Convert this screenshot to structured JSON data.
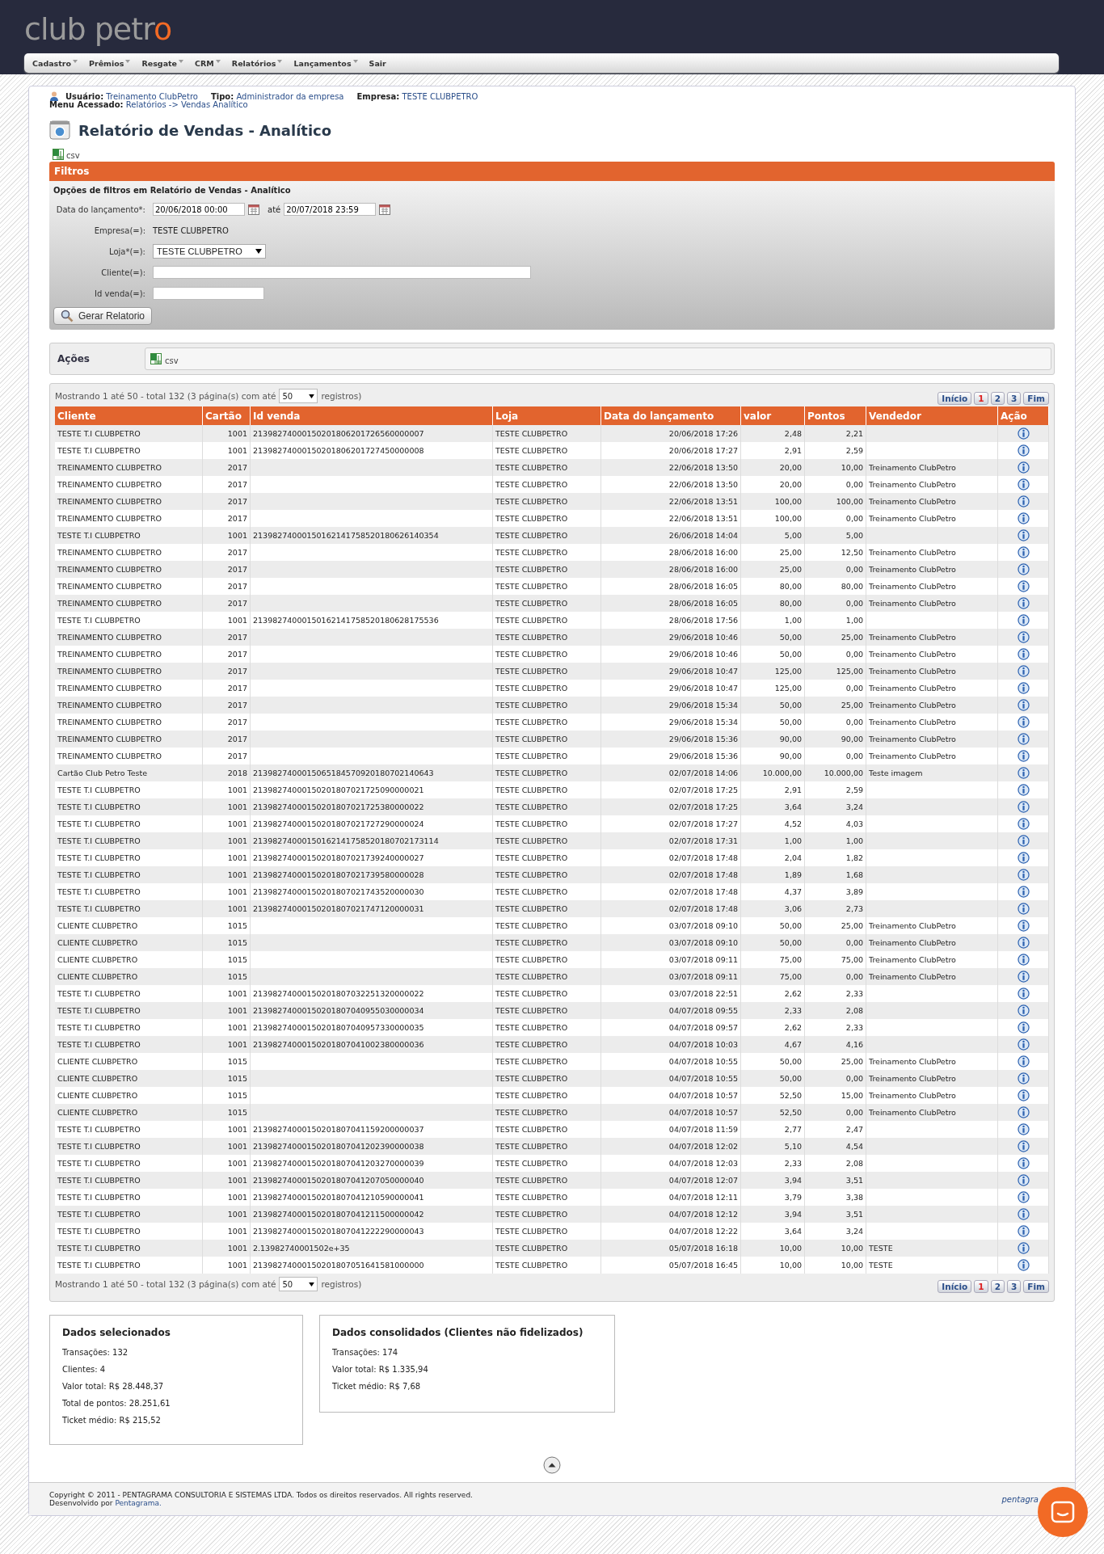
{
  "logo": {
    "text": "club petr",
    "accent": "o"
  },
  "menu": [
    {
      "label": "Cadastro",
      "dropdown": true
    },
    {
      "label": "Prêmios",
      "dropdown": true
    },
    {
      "label": "Resgate",
      "dropdown": true
    },
    {
      "label": "CRM",
      "dropdown": true
    },
    {
      "label": "Relatórios",
      "dropdown": true
    },
    {
      "label": "Lançamentos",
      "dropdown": true
    },
    {
      "label": "Sair",
      "dropdown": false
    }
  ],
  "user_info": [
    {
      "label": "Usuário:",
      "value": "Treinamento ClubPetro"
    },
    {
      "label": "Tipo:",
      "value": "Administrador da empresa"
    },
    {
      "label": "Empresa:",
      "value": "TESTE CLUBPETRO"
    }
  ],
  "menu_path": {
    "label": "Menu Acessado:",
    "value": "Relatórios -> Vendas Analítico"
  },
  "page_title": "Relatório de Vendas - Analítico",
  "export_link": "csv",
  "filters": {
    "title": "Filtros",
    "subtitle": "Opções de filtros em Relatório de Vendas - Analítico",
    "date": {
      "label": "Data do lançamento*:",
      "from": "20/06/2018 00:00",
      "separator": "até",
      "to": "20/07/2018 23:59"
    },
    "company": {
      "label": "Empresa(=):",
      "value": "TESTE CLUBPETRO"
    },
    "store": {
      "label": "Loja*(=):",
      "value": "TESTE CLUBPETRO"
    },
    "client": {
      "label": "Cliente(=):"
    },
    "sale_id": {
      "label": "Id venda(=):"
    },
    "button": "Gerar Relatorio"
  },
  "actions": {
    "label": "Ações",
    "link": "csv"
  },
  "pagers": [
    {
      "summary": "Mostrando 1 até 50 - total 132 (3 página(s) com até",
      "per_page": "50",
      "suffix": "registros)",
      "pages": [
        {
          "label": "Início",
          "selected": false
        },
        {
          "label": "1",
          "selected": true
        },
        {
          "label": "2",
          "selected": false
        },
        {
          "label": "3",
          "selected": false
        },
        {
          "label": "Fim",
          "selected": false
        }
      ]
    },
    {
      "summary": "Mostrando 1 até 50 - total 132 (3 página(s) com até",
      "per_page": "50",
      "suffix": "registros)",
      "pages": [
        {
          "label": "Início",
          "selected": false
        },
        {
          "label": "1",
          "selected": true
        },
        {
          "label": "2",
          "selected": false
        },
        {
          "label": "3",
          "selected": false
        },
        {
          "label": "Fim",
          "selected": false
        }
      ]
    }
  ],
  "table": {
    "columns": [
      "Cliente",
      "Cartão",
      "Id venda",
      "Loja",
      "Data do lançamento",
      "valor",
      "Pontos",
      "Vendedor",
      "Ação"
    ],
    "rows": [
      [
        "TESTE T.I CLUBPETRO",
        "1001",
        "21398274000150201806201726560000007",
        "TESTE CLUBPETRO",
        "20/06/2018 17:26",
        "2,48",
        "2,21",
        ""
      ],
      [
        "TESTE T.I CLUBPETRO",
        "1001",
        "21398274000150201806201727450000008",
        "TESTE CLUBPETRO",
        "20/06/2018 17:27",
        "2,91",
        "2,59",
        ""
      ],
      [
        "TREINAMENTO CLUBPETRO",
        "2017",
        "",
        "TESTE CLUBPETRO",
        "22/06/2018 13:50",
        "20,00",
        "10,00",
        "Treinamento ClubPetro"
      ],
      [
        "TREINAMENTO CLUBPETRO",
        "2017",
        "",
        "TESTE CLUBPETRO",
        "22/06/2018 13:50",
        "20,00",
        "0,00",
        "Treinamento ClubPetro"
      ],
      [
        "TREINAMENTO CLUBPETRO",
        "2017",
        "",
        "TESTE CLUBPETRO",
        "22/06/2018 13:51",
        "100,00",
        "100,00",
        "Treinamento ClubPetro"
      ],
      [
        "TREINAMENTO CLUBPETRO",
        "2017",
        "",
        "TESTE CLUBPETRO",
        "22/06/2018 13:51",
        "100,00",
        "0,00",
        "Treinamento ClubPetro"
      ],
      [
        "TESTE T.I CLUBPETRO",
        "1001",
        "21398274000150162141758520180626140354",
        "TESTE CLUBPETRO",
        "26/06/2018 14:04",
        "5,00",
        "5,00",
        ""
      ],
      [
        "TREINAMENTO CLUBPETRO",
        "2017",
        "",
        "TESTE CLUBPETRO",
        "28/06/2018 16:00",
        "25,00",
        "12,50",
        "Treinamento ClubPetro"
      ],
      [
        "TREINAMENTO CLUBPETRO",
        "2017",
        "",
        "TESTE CLUBPETRO",
        "28/06/2018 16:00",
        "25,00",
        "0,00",
        "Treinamento ClubPetro"
      ],
      [
        "TREINAMENTO CLUBPETRO",
        "2017",
        "",
        "TESTE CLUBPETRO",
        "28/06/2018 16:05",
        "80,00",
        "80,00",
        "Treinamento ClubPetro"
      ],
      [
        "TREINAMENTO CLUBPETRO",
        "2017",
        "",
        "TESTE CLUBPETRO",
        "28/06/2018 16:05",
        "80,00",
        "0,00",
        "Treinamento ClubPetro"
      ],
      [
        "TESTE T.I CLUBPETRO",
        "1001",
        "21398274000150162141758520180628175536",
        "TESTE CLUBPETRO",
        "28/06/2018 17:56",
        "1,00",
        "1,00",
        ""
      ],
      [
        "TREINAMENTO CLUBPETRO",
        "2017",
        "",
        "TESTE CLUBPETRO",
        "29/06/2018 10:46",
        "50,00",
        "25,00",
        "Treinamento ClubPetro"
      ],
      [
        "TREINAMENTO CLUBPETRO",
        "2017",
        "",
        "TESTE CLUBPETRO",
        "29/06/2018 10:46",
        "50,00",
        "0,00",
        "Treinamento ClubPetro"
      ],
      [
        "TREINAMENTO CLUBPETRO",
        "2017",
        "",
        "TESTE CLUBPETRO",
        "29/06/2018 10:47",
        "125,00",
        "125,00",
        "Treinamento ClubPetro"
      ],
      [
        "TREINAMENTO CLUBPETRO",
        "2017",
        "",
        "TESTE CLUBPETRO",
        "29/06/2018 10:47",
        "125,00",
        "0,00",
        "Treinamento ClubPetro"
      ],
      [
        "TREINAMENTO CLUBPETRO",
        "2017",
        "",
        "TESTE CLUBPETRO",
        "29/06/2018 15:34",
        "50,00",
        "25,00",
        "Treinamento ClubPetro"
      ],
      [
        "TREINAMENTO CLUBPETRO",
        "2017",
        "",
        "TESTE CLUBPETRO",
        "29/06/2018 15:34",
        "50,00",
        "0,00",
        "Treinamento ClubPetro"
      ],
      [
        "TREINAMENTO CLUBPETRO",
        "2017",
        "",
        "TESTE CLUBPETRO",
        "29/06/2018 15:36",
        "90,00",
        "90,00",
        "Treinamento ClubPetro"
      ],
      [
        "TREINAMENTO CLUBPETRO",
        "2017",
        "",
        "TESTE CLUBPETRO",
        "29/06/2018 15:36",
        "90,00",
        "0,00",
        "Treinamento ClubPetro"
      ],
      [
        "Cartão Club Petro Teste",
        "2018",
        "2139827400015065184570920180702140643",
        "TESTE CLUBPETRO",
        "02/07/2018 14:06",
        "10.000,00",
        "10.000,00",
        "Teste imagem"
      ],
      [
        "TESTE T.I CLUBPETRO",
        "1001",
        "21398274000150201807021725090000021",
        "TESTE CLUBPETRO",
        "02/07/2018 17:25",
        "2,91",
        "2,59",
        ""
      ],
      [
        "TESTE T.I CLUBPETRO",
        "1001",
        "21398274000150201807021725380000022",
        "TESTE CLUBPETRO",
        "02/07/2018 17:25",
        "3,64",
        "3,24",
        ""
      ],
      [
        "TESTE T.I CLUBPETRO",
        "1001",
        "21398274000150201807021727290000024",
        "TESTE CLUBPETRO",
        "02/07/2018 17:27",
        "4,52",
        "4,03",
        ""
      ],
      [
        "TESTE T.I CLUBPETRO",
        "1001",
        "21398274000150162141758520180702173114",
        "TESTE CLUBPETRO",
        "02/07/2018 17:31",
        "1,00",
        "1,00",
        ""
      ],
      [
        "TESTE T.I CLUBPETRO",
        "1001",
        "21398274000150201807021739240000027",
        "TESTE CLUBPETRO",
        "02/07/2018 17:48",
        "2,04",
        "1,82",
        ""
      ],
      [
        "TESTE T.I CLUBPETRO",
        "1001",
        "21398274000150201807021739580000028",
        "TESTE CLUBPETRO",
        "02/07/2018 17:48",
        "1,89",
        "1,68",
        ""
      ],
      [
        "TESTE T.I CLUBPETRO",
        "1001",
        "21398274000150201807021743520000030",
        "TESTE CLUBPETRO",
        "02/07/2018 17:48",
        "4,37",
        "3,89",
        ""
      ],
      [
        "TESTE T.I CLUBPETRO",
        "1001",
        "21398274000150201807021747120000031",
        "TESTE CLUBPETRO",
        "02/07/2018 17:48",
        "3,06",
        "2,73",
        ""
      ],
      [
        "CLIENTE CLUBPETRO",
        "1015",
        "",
        "TESTE CLUBPETRO",
        "03/07/2018 09:10",
        "50,00",
        "25,00",
        "Treinamento ClubPetro"
      ],
      [
        "CLIENTE CLUBPETRO",
        "1015",
        "",
        "TESTE CLUBPETRO",
        "03/07/2018 09:10",
        "50,00",
        "0,00",
        "Treinamento ClubPetro"
      ],
      [
        "CLIENTE CLUBPETRO",
        "1015",
        "",
        "TESTE CLUBPETRO",
        "03/07/2018 09:11",
        "75,00",
        "75,00",
        "Treinamento ClubPetro"
      ],
      [
        "CLIENTE CLUBPETRO",
        "1015",
        "",
        "TESTE CLUBPETRO",
        "03/07/2018 09:11",
        "75,00",
        "0,00",
        "Treinamento ClubPetro"
      ],
      [
        "TESTE T.I CLUBPETRO",
        "1001",
        "21398274000150201807032251320000022",
        "TESTE CLUBPETRO",
        "03/07/2018 22:51",
        "2,62",
        "2,33",
        ""
      ],
      [
        "TESTE T.I CLUBPETRO",
        "1001",
        "21398274000150201807040955030000034",
        "TESTE CLUBPETRO",
        "04/07/2018 09:55",
        "2,33",
        "2,08",
        ""
      ],
      [
        "TESTE T.I CLUBPETRO",
        "1001",
        "21398274000150201807040957330000035",
        "TESTE CLUBPETRO",
        "04/07/2018 09:57",
        "2,62",
        "2,33",
        ""
      ],
      [
        "TESTE T.I CLUBPETRO",
        "1001",
        "21398274000150201807041002380000036",
        "TESTE CLUBPETRO",
        "04/07/2018 10:03",
        "4,67",
        "4,16",
        ""
      ],
      [
        "CLIENTE CLUBPETRO",
        "1015",
        "",
        "TESTE CLUBPETRO",
        "04/07/2018 10:55",
        "50,00",
        "25,00",
        "Treinamento ClubPetro"
      ],
      [
        "CLIENTE CLUBPETRO",
        "1015",
        "",
        "TESTE CLUBPETRO",
        "04/07/2018 10:55",
        "50,00",
        "0,00",
        "Treinamento ClubPetro"
      ],
      [
        "CLIENTE CLUBPETRO",
        "1015",
        "",
        "TESTE CLUBPETRO",
        "04/07/2018 10:57",
        "52,50",
        "15,00",
        "Treinamento ClubPetro"
      ],
      [
        "CLIENTE CLUBPETRO",
        "1015",
        "",
        "TESTE CLUBPETRO",
        "04/07/2018 10:57",
        "52,50",
        "0,00",
        "Treinamento ClubPetro"
      ],
      [
        "TESTE T.I CLUBPETRO",
        "1001",
        "21398274000150201807041159200000037",
        "TESTE CLUBPETRO",
        "04/07/2018 11:59",
        "2,77",
        "2,47",
        ""
      ],
      [
        "TESTE T.I CLUBPETRO",
        "1001",
        "21398274000150201807041202390000038",
        "TESTE CLUBPETRO",
        "04/07/2018 12:02",
        "5,10",
        "4,54",
        ""
      ],
      [
        "TESTE T.I CLUBPETRO",
        "1001",
        "21398274000150201807041203270000039",
        "TESTE CLUBPETRO",
        "04/07/2018 12:03",
        "2,33",
        "2,08",
        ""
      ],
      [
        "TESTE T.I CLUBPETRO",
        "1001",
        "21398274000150201807041207050000040",
        "TESTE CLUBPETRO",
        "04/07/2018 12:07",
        "3,94",
        "3,51",
        ""
      ],
      [
        "TESTE T.I CLUBPETRO",
        "1001",
        "21398274000150201807041210590000041",
        "TESTE CLUBPETRO",
        "04/07/2018 12:11",
        "3,79",
        "3,38",
        ""
      ],
      [
        "TESTE T.I CLUBPETRO",
        "1001",
        "21398274000150201807041211500000042",
        "TESTE CLUBPETRO",
        "04/07/2018 12:12",
        "3,94",
        "3,51",
        ""
      ],
      [
        "TESTE T.I CLUBPETRO",
        "1001",
        "21398274000150201807041222290000043",
        "TESTE CLUBPETRO",
        "04/07/2018 12:22",
        "3,64",
        "3,24",
        ""
      ],
      [
        "TESTE T.I CLUBPETRO",
        "1001",
        "2.13982740001502e+35",
        "TESTE CLUBPETRO",
        "05/07/2018 16:18",
        "10,00",
        "10,00",
        "TESTE"
      ],
      [
        "TESTE T.I CLUBPETRO",
        "1001",
        "21398274000150201807051641581000000",
        "TESTE CLUBPETRO",
        "05/07/2018 16:45",
        "10,00",
        "10,00",
        "TESTE"
      ]
    ]
  },
  "summaries": [
    {
      "title": "Dados selecionados",
      "lines": [
        "Transações: 132",
        "Clientes: 4",
        "Valor total: R$ 28.448,37",
        "Total de pontos: 28.251,61",
        "Ticket médio: R$ 215,52"
      ]
    },
    {
      "title": "Dados consolidados (Clientes não fidelizados)",
      "lines": [
        "Transações: 174",
        "Valor total: R$ 1.335,94",
        "Ticket médio: R$ 7,68"
      ]
    }
  ],
  "footer": {
    "copyright": "Copyright © 2011 - PENTAGRAMA CONSULTORIA E SISTEMAS LTDA. Todos os direitos reservados. All rights reserved.",
    "developed_by": "Desenvolvido por",
    "developer": "Pentagrama.",
    "logo": "pentagra"
  }
}
